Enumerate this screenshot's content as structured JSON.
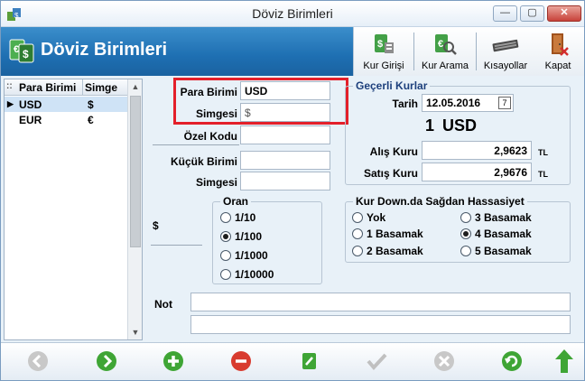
{
  "window": {
    "title": "Döviz Birimleri",
    "min_label": "—",
    "max_label": "▢",
    "close_label": "✕"
  },
  "header": {
    "title": "Döviz Birimleri",
    "toolbar": {
      "kur_girisi": "Kur Girişi",
      "kur_arama": "Kur Arama",
      "kisayollar": "Kısayollar",
      "kapat": "Kapat"
    }
  },
  "grid": {
    "col1": "Para Birimi",
    "col2": "Simge",
    "rows": [
      {
        "code": "USD",
        "symbol": "$"
      },
      {
        "code": "EUR",
        "symbol": "€"
      }
    ]
  },
  "form": {
    "para_birimi_label": "Para Birimi",
    "para_birimi_value": "USD",
    "simgesi_label": "Simgesi",
    "simgesi_value": "$",
    "ozel_kodu_label": "Özel Kodu",
    "kucuk_birimi_label": "Küçük Birimi",
    "kucuk_simgesi_label": "Simgesi",
    "dollar_symbol": "$",
    "oran": {
      "title": "Oran",
      "options": [
        "1/10",
        "1/100",
        "1/1000",
        "1/10000"
      ],
      "selected": 1
    },
    "not_label": "Not"
  },
  "rates": {
    "title": "Geçerli Kurlar",
    "tarih_label": "Tarih",
    "tarih_value": "12.05.2016",
    "calendar_glyph": "7",
    "unit_amount": "1",
    "unit_code": "USD",
    "alis_label": "Alış Kuru",
    "alis_value": "2,9623",
    "satis_label": "Satış Kuru",
    "satis_value": "2,9676",
    "currency_suffix": "TL"
  },
  "precision": {
    "title": "Kur Down.da Sağdan Hassasiyet",
    "options": [
      "Yok",
      "3 Basamak",
      "1 Basamak",
      "4 Basamak",
      "2 Basamak",
      "5 Basamak"
    ],
    "selected": 3
  },
  "colors": {
    "header_blue": "#1e6fb2",
    "highlight_red": "#e3202a",
    "selected_row": "#cfe3f6"
  }
}
